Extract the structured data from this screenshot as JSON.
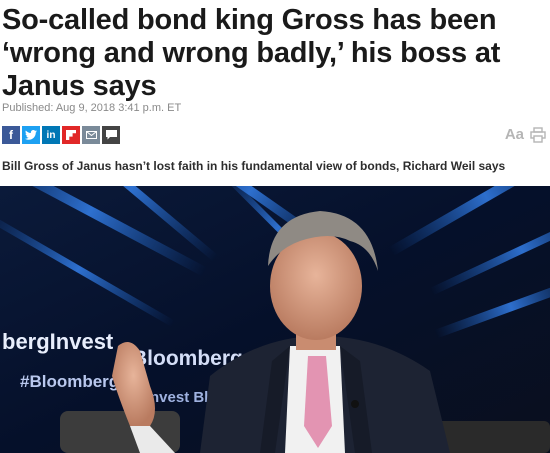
{
  "article": {
    "headline": "So-called bond king Gross has been ‘wrong and wrong badly,’ his boss at Janus says",
    "published": "Published: Aug 9, 2018 3:41 p.m. ET",
    "subhead": "Bill Gross of Janus hasn’t lost faith in his fundamental view of bonds, Richard Weil says"
  },
  "share": [
    {
      "name": "facebook",
      "icon": "facebook-icon",
      "color": "#3b5998",
      "glyph": "f"
    },
    {
      "name": "twitter",
      "icon": "twitter-icon",
      "color": "#1da1f2",
      "glyph": ""
    },
    {
      "name": "linkedin",
      "icon": "linkedin-icon",
      "color": "#0077b5",
      "glyph": "in"
    },
    {
      "name": "flipboard",
      "icon": "flipboard-icon",
      "color": "#e12828",
      "glyph": ""
    },
    {
      "name": "email",
      "icon": "email-icon",
      "color": "#7a8a99",
      "glyph": ""
    },
    {
      "name": "comments",
      "icon": "comment-icon",
      "color": "#444444",
      "glyph": ""
    }
  ],
  "tools": {
    "font_size_label": "Aa"
  },
  "photo": {
    "screen_text_1": "bergInvest",
    "screen_text_2": "Bloomberg",
    "screen_text_3": "#Bloomberg",
    "screen_text_4": "nvest Bl",
    "screen_text_5": "mberg"
  }
}
